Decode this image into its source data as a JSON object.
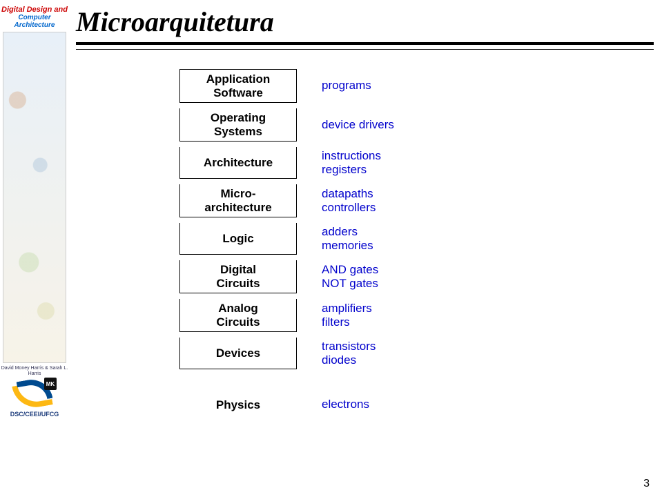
{
  "sidebar": {
    "book_title_line1": "Digital Design and",
    "book_title_line2": "Computer Architecture",
    "authors": "David Money Harris & Sarah L. Harris",
    "mk": "MK",
    "footer": "DSC/CEEI/UFCG"
  },
  "slide": {
    "title": "Microarquitetura",
    "page_number": "3"
  },
  "layers": [
    {
      "label": "Application\nSoftware",
      "desc": "programs",
      "boxed": true,
      "group": "stack"
    },
    {
      "label": "Operating\nSystems",
      "desc": "device drivers",
      "boxed": true,
      "group": "stack"
    },
    {
      "label": "Architecture",
      "desc": "instructions\nregisters",
      "boxed": true,
      "group": "stack"
    },
    {
      "label": "Micro-\narchitecture",
      "desc": "datapaths\ncontrollers",
      "boxed": true,
      "group": "stack"
    },
    {
      "label": "Logic",
      "desc": "adders\nmemories",
      "boxed": true,
      "group": "stack"
    },
    {
      "label": "Digital\nCircuits",
      "desc": "AND gates\nNOT gates",
      "boxed": true,
      "group": "stack"
    },
    {
      "label": "Analog\nCircuits",
      "desc": "amplifiers\nfilters",
      "boxed": true,
      "group": "stack"
    },
    {
      "label": "Devices",
      "desc": "transistors\ndiodes",
      "boxed": true,
      "group": "stack"
    },
    {
      "label": "Physics",
      "desc": "electrons",
      "boxed": false,
      "group": "lone"
    }
  ]
}
